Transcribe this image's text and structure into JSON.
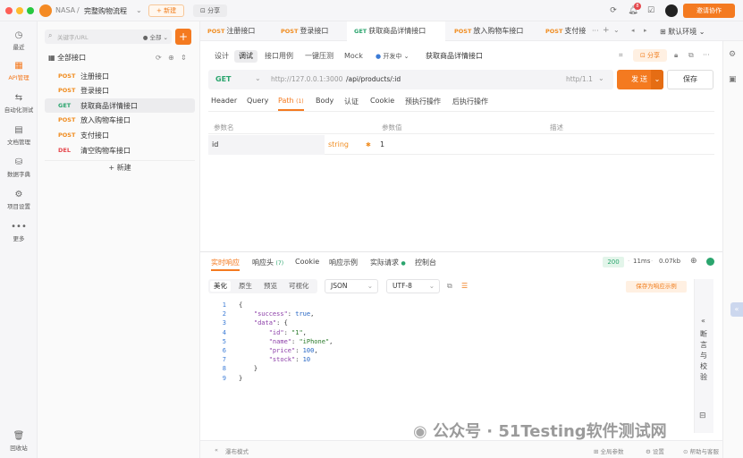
{
  "titlebar": {
    "workspace": "NASA",
    "separator": "/",
    "project": "完整购物流程",
    "new_label": "+ 新建",
    "share_label": "分享",
    "notif_count": "8",
    "invite_label": "邀请协作"
  },
  "rail": {
    "items": [
      {
        "label": "最近",
        "icon": "clock-icon"
      },
      {
        "label": "API管理",
        "icon": "api-icon"
      },
      {
        "label": "自动化测试",
        "icon": "flow-icon"
      },
      {
        "label": "文档管理",
        "icon": "doc-icon"
      },
      {
        "label": "数据字典",
        "icon": "db-icon"
      },
      {
        "label": "项目设置",
        "icon": "settings-icon"
      },
      {
        "label": "更多",
        "icon": "more-icon"
      }
    ],
    "trash": "回收站"
  },
  "sidebar": {
    "search_placeholder": "关键字/URL",
    "filter": "全部",
    "root": "全部接口",
    "items": [
      {
        "method": "POST",
        "name": "注册接口"
      },
      {
        "method": "POST",
        "name": "登录接口"
      },
      {
        "method": "GET",
        "name": "获取商品详情接口"
      },
      {
        "method": "POST",
        "name": "放入购物车接口"
      },
      {
        "method": "POST",
        "name": "支付接口"
      },
      {
        "method": "DEL",
        "name": "清空购物车接口"
      }
    ],
    "new_label": "+ 新建"
  },
  "tabs": [
    {
      "method": "POST",
      "name": "注册接口"
    },
    {
      "method": "POST",
      "name": "登录接口"
    },
    {
      "method": "GET",
      "name": "获取商品详情接口"
    },
    {
      "method": "POST",
      "name": "放入购物车接口"
    },
    {
      "method": "POST",
      "name": "支付接"
    }
  ],
  "env": "默认环境",
  "mode_tabs": [
    "设计",
    "调试",
    "接口用例",
    "一键压测",
    "Mock"
  ],
  "status_label": "开发中",
  "api_title": "获取商品详情接口",
  "share_btn": "分享",
  "request": {
    "method": "GET",
    "base_url": "http://127.0.0.1:3000",
    "path": "/api/products/:id",
    "protocol": "http/1.1",
    "send": "发送",
    "save": "保存"
  },
  "req_tabs": [
    "Header",
    "Query",
    "Path",
    "Body",
    "认证",
    "Cookie",
    "预执行操作",
    "后执行操作"
  ],
  "path_count": "(1)",
  "params": {
    "headers": [
      "参数名",
      "参数值",
      "描述"
    ],
    "row": {
      "name": "id",
      "type": "string",
      "value": "1"
    }
  },
  "response": {
    "tabs": [
      "实时响应",
      "响应头",
      "Cookie",
      "响应示例",
      "实际请求",
      "控制台"
    ],
    "header_count": "(7)",
    "status": "200",
    "time": "11ms",
    "size": "0.07kb",
    "view_tabs": [
      "美化",
      "原生",
      "预览",
      "可视化"
    ],
    "format": "JSON",
    "encoding": "UTF-8",
    "save_example": "保存为响应示例",
    "assertion": "断言与校验",
    "lines": [
      {
        "n": "1",
        "t": "{"
      },
      {
        "n": "2",
        "t": "    \"success\": true,"
      },
      {
        "n": "3",
        "t": "    \"data\": {"
      },
      {
        "n": "4",
        "t": "        \"id\": \"1\","
      },
      {
        "n": "5",
        "t": "        \"name\": \"iPhone\","
      },
      {
        "n": "6",
        "t": "        \"price\": 100,"
      },
      {
        "n": "7",
        "t": "        \"stock\": 10"
      },
      {
        "n": "8",
        "t": "    }"
      },
      {
        "n": "9",
        "t": "}"
      }
    ]
  },
  "footer": {
    "mode": "瀑布模式",
    "global_params": "全局参数",
    "settings": "设置",
    "help": "帮助与客服"
  },
  "watermark": "公众号 · 51Testing软件测试网",
  "colors": {
    "accent": "#f47a20",
    "get": "#2ba56e",
    "post": "#f08c1f",
    "del": "#e5484d"
  }
}
